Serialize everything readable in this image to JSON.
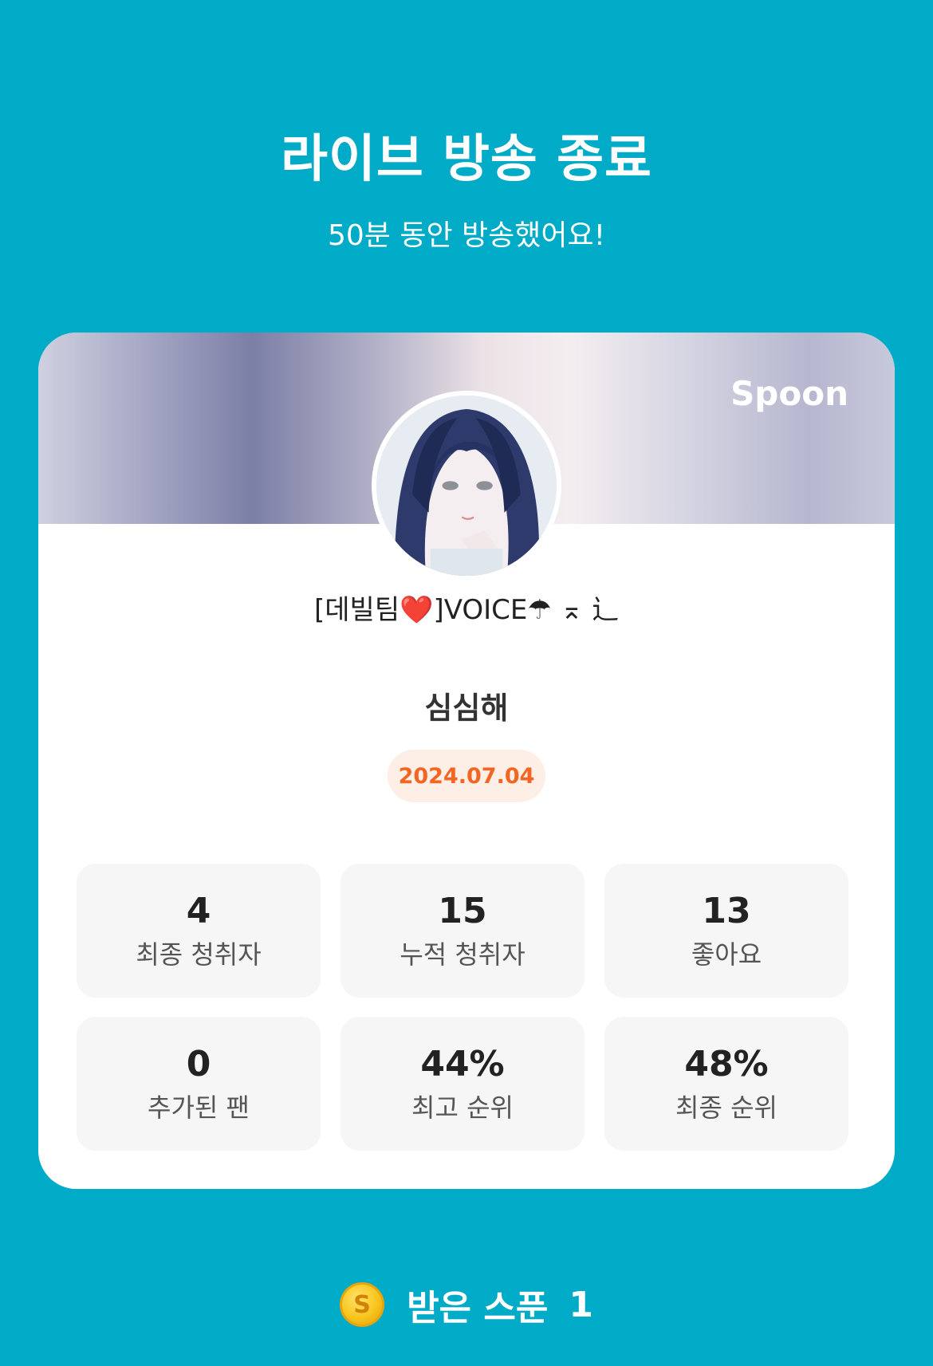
{
  "header": {
    "title": "라이브 방송 종료",
    "subtitle": "50분 동안 방송했어요!"
  },
  "card": {
    "brand": "Spoon",
    "nickname": "[데빌팀❤️]VOICE☂︎ ⌅ ⻌",
    "room_title": "심심해",
    "date": "2024.07.04"
  },
  "stats": [
    {
      "value": "4",
      "label": "최종 청취자"
    },
    {
      "value": "15",
      "label": "누적 청취자"
    },
    {
      "value": "13",
      "label": "좋아요"
    },
    {
      "value": "0",
      "label": "추가된 팬"
    },
    {
      "value": "44%",
      "label": "최고 순위"
    },
    {
      "value": "48%",
      "label": "최종 순위"
    }
  ],
  "spoons": {
    "coin_symbol": "S",
    "label": "받은 스푼",
    "count": "1"
  },
  "colors": {
    "background": "#00abc7",
    "date_text": "#f26522",
    "date_badge": "#fdeee6",
    "stat_box": "#f6f6f6"
  }
}
